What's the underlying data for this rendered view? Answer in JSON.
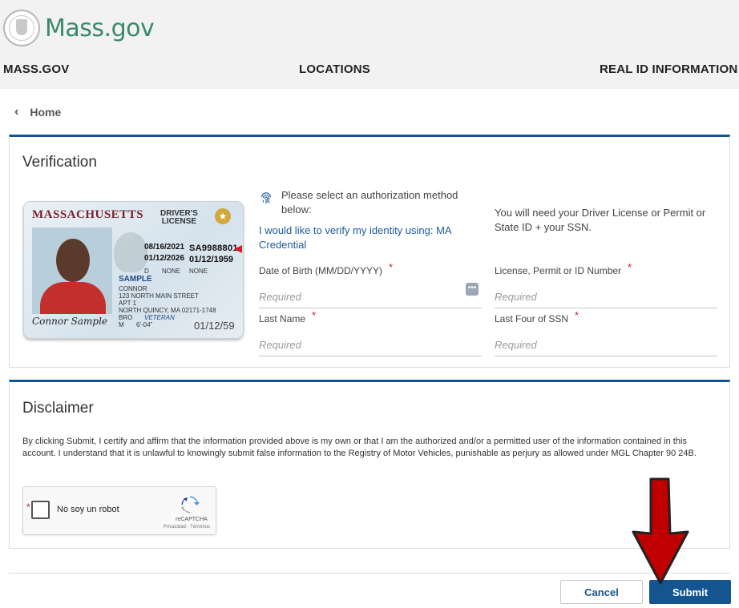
{
  "header": {
    "brand_text": "Mass.gov",
    "nav": [
      "MASS.GOV",
      "LOCATIONS",
      "REAL ID INFORMATION"
    ]
  },
  "breadcrumb": {
    "chevron": "‹",
    "label": "Home"
  },
  "verification": {
    "title": "Verification",
    "auth_prompt": "Please select an authorization method below:",
    "auth_method": "I would like to verify my identity using: MA Credential",
    "requirement_note": "You will need your Driver License or Permit or State ID + your SSN.",
    "fields": {
      "dob": {
        "label": "Date of Birth (MM/DD/YYYY)",
        "placeholder": "Required",
        "required_mark": "*"
      },
      "license": {
        "label": "License, Permit or ID Number",
        "placeholder": "Required",
        "required_mark": "*"
      },
      "last_name": {
        "label": "Last Name",
        "placeholder": "Required",
        "required_mark": "*"
      },
      "ssn": {
        "label": "Last Four of SSN",
        "placeholder": "Required",
        "required_mark": "*"
      }
    },
    "license_card": {
      "state": "MASSACHUSETTS",
      "type_line1": "DRIVER'S",
      "type_line2": "LICENSE",
      "id_number": "SA9988801",
      "iss_date": "08/16/2021",
      "exp_date": "01/12/2026",
      "dob": "01/12/1959",
      "class": "D",
      "rest": "NONE",
      "end": "NONE",
      "name_last": "SAMPLE",
      "name_first": "CONNOR",
      "address1": "123 NORTH MAIN STREET",
      "address2": "APT 1",
      "address3": "NORTH QUINCY, MA 02171-1748",
      "eyes": "BRO",
      "sex": "M",
      "height": "6'-04\"",
      "veteran": "VETERAN",
      "signature": "Connor Sample",
      "dob_small": "01/12/59"
    }
  },
  "disclaimer": {
    "title": "Disclaimer",
    "text": "By clicking Submit, I certify and affirm that the information provided above is my own or that I am the authorized and/or a permitted user of the information contained in this account. I understand that it is unlawful to knowingly submit false information to the Registry of Motor Vehicles, punishable as perjury as allowed under MGL Chapter 90 24B.",
    "recaptcha": {
      "label": "No soy un robot",
      "required_mark": "*",
      "brand": "reCAPTCHA",
      "links": "Privacidad - Términos"
    }
  },
  "buttons": {
    "cancel": "Cancel",
    "submit": "Submit"
  },
  "colors": {
    "primary": "#14558f",
    "brand_green": "#3a8a6a",
    "required": "#c0272d",
    "annotation_arrow": "#c00000"
  }
}
